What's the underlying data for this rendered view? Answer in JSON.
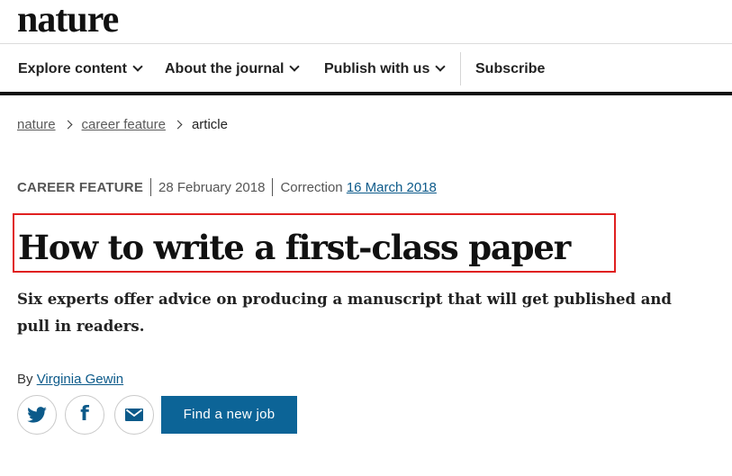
{
  "site": {
    "logo": "nature"
  },
  "nav": {
    "items": [
      {
        "label": "Explore content",
        "has_menu": true
      },
      {
        "label": "About the journal",
        "has_menu": true
      },
      {
        "label": "Publish with us",
        "has_menu": true
      }
    ],
    "subscribe_label": "Subscribe"
  },
  "breadcrumb": [
    "nature",
    "career feature",
    "article"
  ],
  "article": {
    "type": "CAREER FEATURE",
    "date": "28 February 2018",
    "correction_label": "Correction",
    "correction_date": "16 March 2018",
    "title": "How to write a first-class paper",
    "standfirst": "Six experts offer advice on producing a manuscript that will get published and pull in readers.",
    "byline_prefix": "By",
    "author": "Virginia Gewin"
  },
  "share": [
    {
      "icon": "twitter-icon"
    },
    {
      "icon": "facebook-icon",
      "glyph": "f"
    },
    {
      "icon": "email-icon"
    }
  ],
  "cta": {
    "label": "Find a new job"
  },
  "colors": {
    "link": "#0c5a8a",
    "button": "#0c6497",
    "highlight_border": "#e02020"
  }
}
